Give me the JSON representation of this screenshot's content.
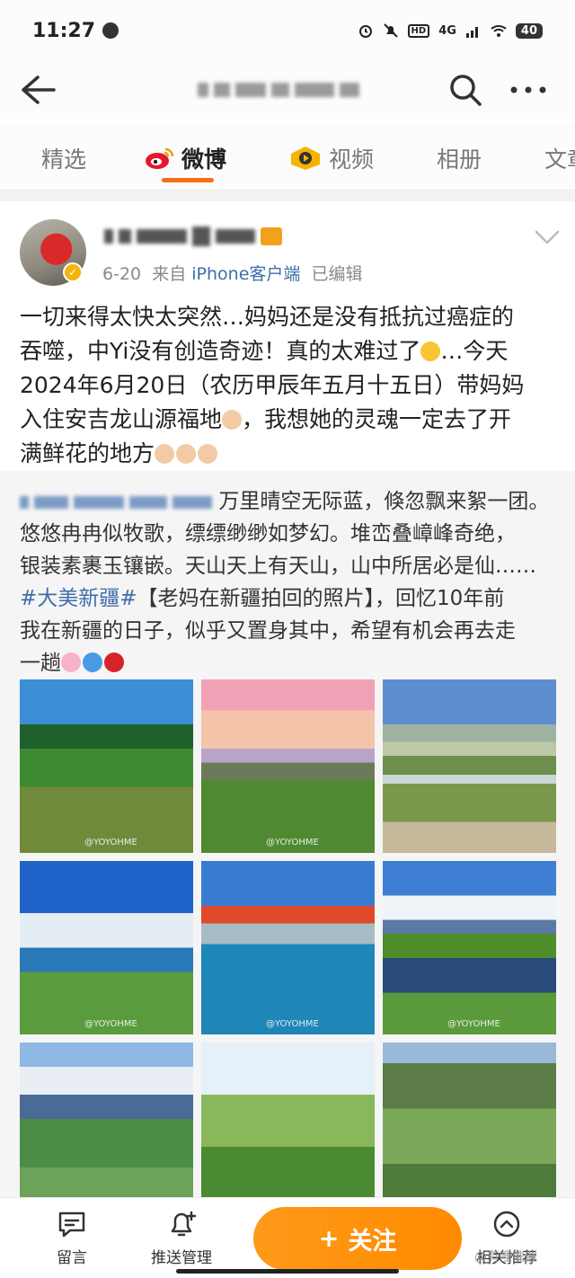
{
  "status_bar": {
    "time": "11:27",
    "network": "4G",
    "battery": "40"
  },
  "nav": {
    "icons": [
      "back-arrow-icon",
      "search-icon",
      "more-icon"
    ]
  },
  "tabs": [
    {
      "label": "精选",
      "active": false
    },
    {
      "label": "微博",
      "active": true,
      "icon": "weibo-logo-icon"
    },
    {
      "label": "视频",
      "active": false,
      "icon": "video-icon"
    },
    {
      "label": "相册",
      "active": false
    },
    {
      "label": "文章",
      "active": false
    }
  ],
  "post": {
    "date": "6-20",
    "source_prefix": "来自",
    "source": "iPhone客户端",
    "edited": "已编辑",
    "text_line1": "一切来得太快太突然…妈妈还是没有抵抗过癌症的",
    "text_line2": "吞噬，中Yi没有创造奇迹！真的太难过了",
    "text_line2b": "…今天",
    "text_line3": "2024年6月20日（农历甲辰年五月十五日）带妈妈",
    "text_line4": "入住安吉龙山源福地",
    "text_line4b": "，我想她的灵魂一定去了开",
    "text_line5": "满鲜花的地方"
  },
  "repost": {
    "line1": "万里晴空无际蓝，倏忽飘来絮一团。",
    "line2": "悠悠冉冉似牧歌，缥缥缈缈如梦幻。堆峦叠嶂峰奇绝，",
    "line3": "银装素裹玉镶嵌。天山天上有天山，山中所居必是仙……",
    "hashtag": "#大美新疆#",
    "line4": "【老妈在新疆拍回的照片】，回忆10年前",
    "line5": "我在新疆的日子，似乎又置身其中，希望有机会再去走",
    "line6": "一趟",
    "photo_watermark": "@YOYOHME"
  },
  "bottom_bar": {
    "comment": "留言",
    "push": "推送管理",
    "follow": "关注",
    "follow_plus": "+",
    "related": "相关推荐"
  },
  "footer_watermark": "@有哩催催"
}
